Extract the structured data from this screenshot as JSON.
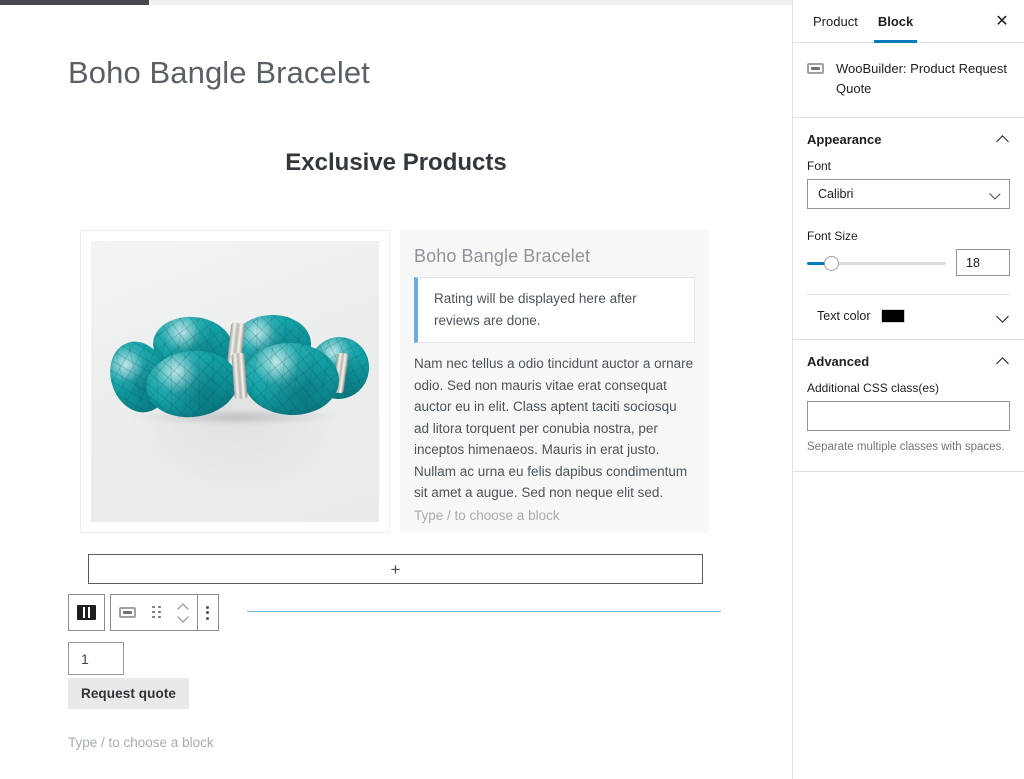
{
  "editor": {
    "post_title": "Boho Bangle Bracelet",
    "section_heading": "Exclusive Products",
    "product": {
      "name": "Boho Bangle Bracelet",
      "rating_notice": "Rating will be displayed here after reviews are done.",
      "description": "Nam nec tellus a odio tincidunt auctor a ornare odio. Sed non mauris vitae erat consequat auctor eu in elit. Class aptent taciti sociosqu ad litora torquent per conubia nostra, per inceptos himenaeos. Mauris in erat justo. Nullam ac urna eu felis dapibus condimentum sit amet a augue. Sed non neque elit sed.",
      "column_placeholder": "Type / to choose a block",
      "image_alt": "Turquoise beaded bangle bracelet"
    },
    "appender_label": "+",
    "quantity_value": "1",
    "request_quote_label": "Request quote",
    "bottom_placeholder": "Type / to choose a block",
    "toolbar": {
      "parent_block_icon": "media-and-text-icon",
      "block_type_icon": "woobuilder-block-icon",
      "drag_icon": "drag-handle-icon",
      "move_up_icon": "chevron-up-icon",
      "move_down_icon": "chevron-down-icon",
      "options_icon": "kebab-menu-icon"
    }
  },
  "sidebar": {
    "tabs": [
      {
        "label": "Product",
        "active": false
      },
      {
        "label": "Block",
        "active": true
      }
    ],
    "close_icon": "close-icon",
    "close_label": "✕",
    "block_card": {
      "icon": "woobuilder-block-icon",
      "label": "WooBuilder: Product Request Quote"
    },
    "appearance": {
      "title": "Appearance",
      "collapse_icon": "chevron-up-icon",
      "font_label": "Font",
      "font_value": "Calibri",
      "font_dropdown_icon": "chevron-down-icon",
      "font_size_label": "Font Size",
      "font_size_value": "18",
      "slider_percent": 17,
      "text_color_label": "Text color",
      "text_color_value": "#000000",
      "text_color_caret_icon": "chevron-down-icon"
    },
    "advanced": {
      "title": "Advanced",
      "collapse_icon": "chevron-up-icon",
      "css_label": "Additional CSS class(es)",
      "css_value": "",
      "css_placeholder": "",
      "help_text": "Separate multiple classes with spaces."
    }
  },
  "colors": {
    "accent": "#007cba",
    "quote_bar": "#6aaedd",
    "insert_line": "#7eb5d6",
    "column_bg": "#f7f7f7",
    "button_bg": "#e9e9e9"
  }
}
